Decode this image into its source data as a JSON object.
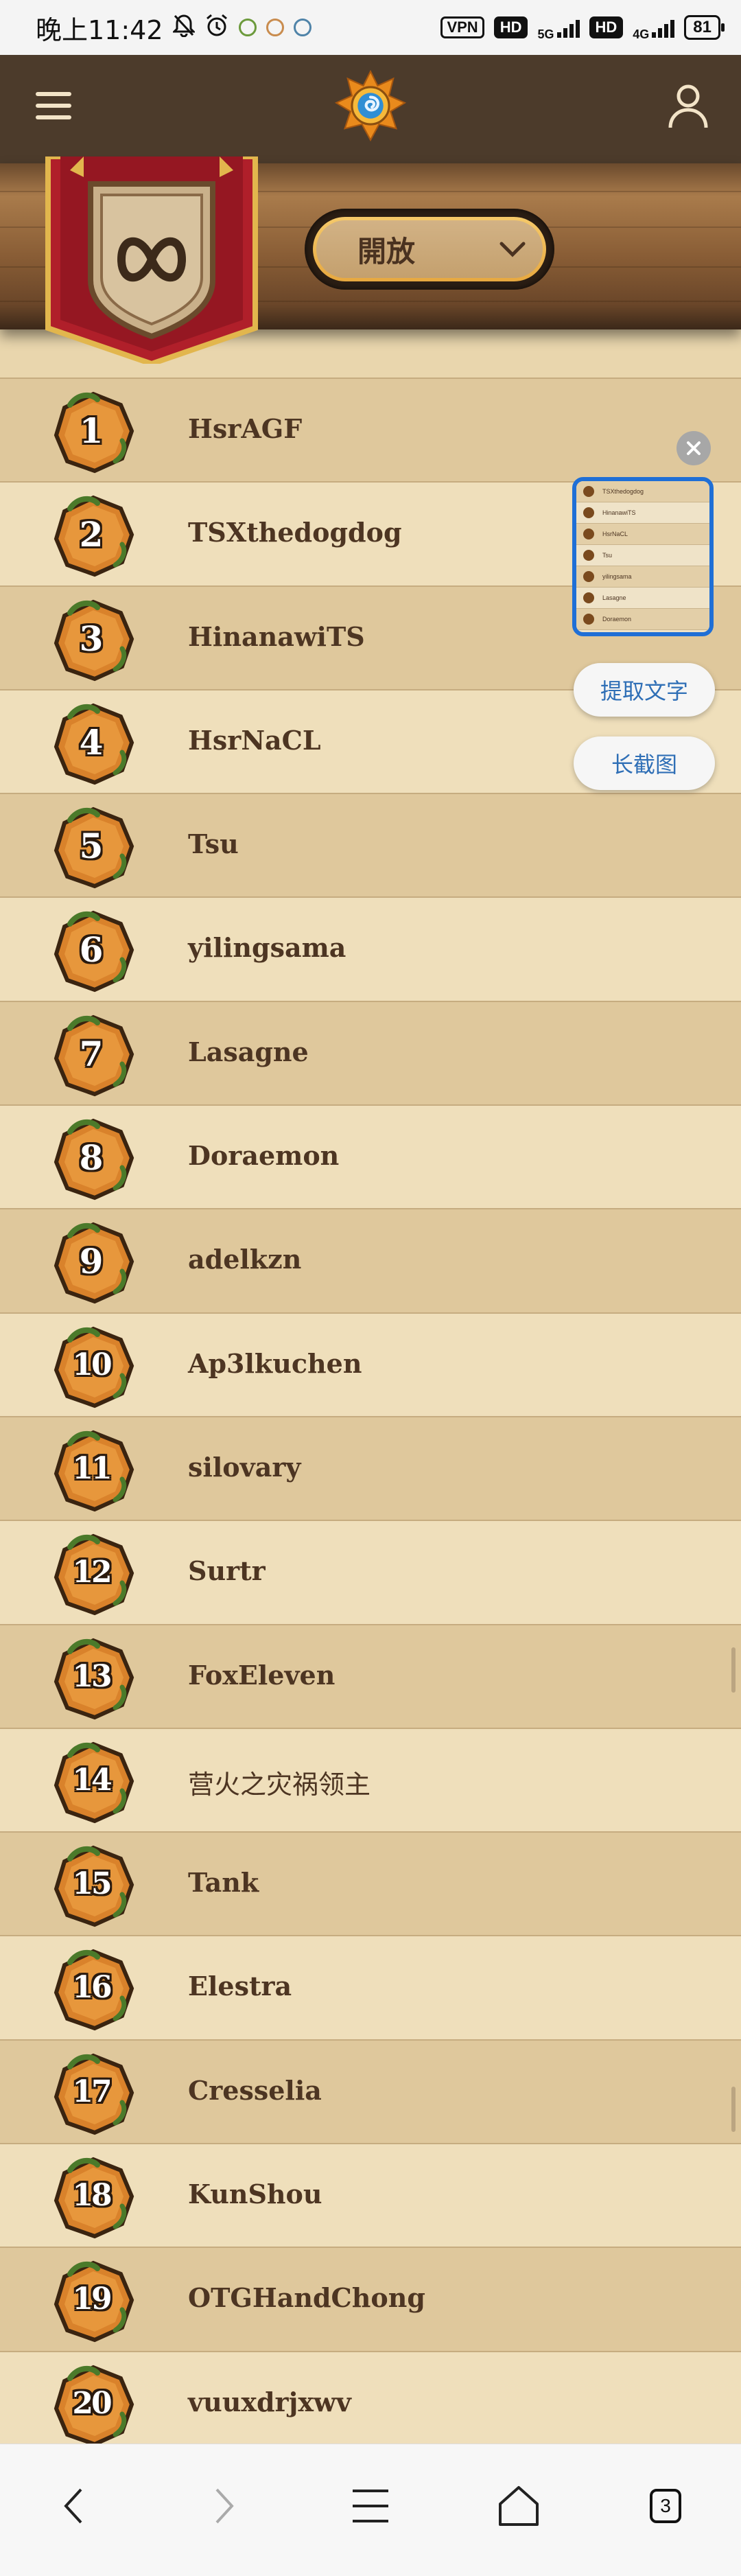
{
  "status_bar": {
    "time": "晚上11:42",
    "vpn": "VPN",
    "hd1": "HD",
    "net1": "5G",
    "hd2": "HD",
    "net2": "4G",
    "battery": "81"
  },
  "header": {
    "dropdown_value": "開放"
  },
  "leaderboard": [
    {
      "rank": "1",
      "name": "HsrAGF"
    },
    {
      "rank": "2",
      "name": "TSXthedogdog"
    },
    {
      "rank": "3",
      "name": "HinanawiTS"
    },
    {
      "rank": "4",
      "name": "HsrNaCL"
    },
    {
      "rank": "5",
      "name": "Tsu"
    },
    {
      "rank": "6",
      "name": "yilingsama"
    },
    {
      "rank": "7",
      "name": "Lasagne"
    },
    {
      "rank": "8",
      "name": "Doraemon"
    },
    {
      "rank": "9",
      "name": "adelkzn"
    },
    {
      "rank": "10",
      "name": "Ap3lkuchen"
    },
    {
      "rank": "11",
      "name": "silovary"
    },
    {
      "rank": "12",
      "name": "Surtr"
    },
    {
      "rank": "13",
      "name": "FoxEleven"
    },
    {
      "rank": "14",
      "name": "营火之灾祸领主"
    },
    {
      "rank": "15",
      "name": "Tank"
    },
    {
      "rank": "16",
      "name": "Elestra"
    },
    {
      "rank": "17",
      "name": "Cresselia"
    },
    {
      "rank": "18",
      "name": "KunShou"
    },
    {
      "rank": "19",
      "name": "OTGHandChong"
    },
    {
      "rank": "20",
      "name": "vuuxdrjxwv"
    }
  ],
  "screenshot_overlay": {
    "thumbnail_rows": [
      "TSXthedogdog",
      "HinanawiTS",
      "HsrNaCL",
      "Tsu",
      "yilingsama",
      "Lasagne",
      "Doraemon"
    ],
    "extract_text_label": "提取文字",
    "long_screenshot_label": "长截图"
  },
  "navbar": {
    "tab_count": "3"
  },
  "colors": {
    "accent_blue": "#1f6fd6",
    "header_brown": "#4c3b2b",
    "name_text": "#4d3522"
  }
}
